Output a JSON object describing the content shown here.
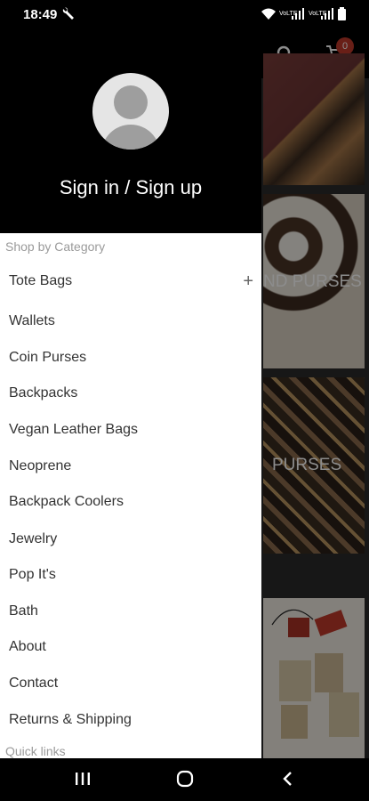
{
  "status_bar": {
    "time": "18:49",
    "battery_label": "battery"
  },
  "app_bar": {
    "cart_count": "0"
  },
  "background_tiles": {
    "tile2_label": "ND PURSES",
    "tile3_label": "PURSES"
  },
  "drawer": {
    "sign_in_label": "Sign in / Sign up",
    "section_title": "Shop by Category",
    "items": [
      {
        "label": "Tote Bags",
        "expandable": true
      },
      {
        "label": "Wallets"
      },
      {
        "label": "Coin Purses"
      },
      {
        "label": "Backpacks"
      },
      {
        "label": "Vegan Leather Bags"
      },
      {
        "label": "Neoprene"
      },
      {
        "label": "Backpack Coolers"
      },
      {
        "label": "Jewelry"
      },
      {
        "label": "Pop It's"
      },
      {
        "label": "Bath"
      },
      {
        "label": "About"
      },
      {
        "label": "Contact"
      },
      {
        "label": "Returns & Shipping"
      }
    ],
    "quick_links_title": "Quick links",
    "expand_symbol": "+"
  },
  "colors": {
    "header_bg": "#000000",
    "drawer_bg": "#ffffff",
    "badge": "#c0392b"
  }
}
